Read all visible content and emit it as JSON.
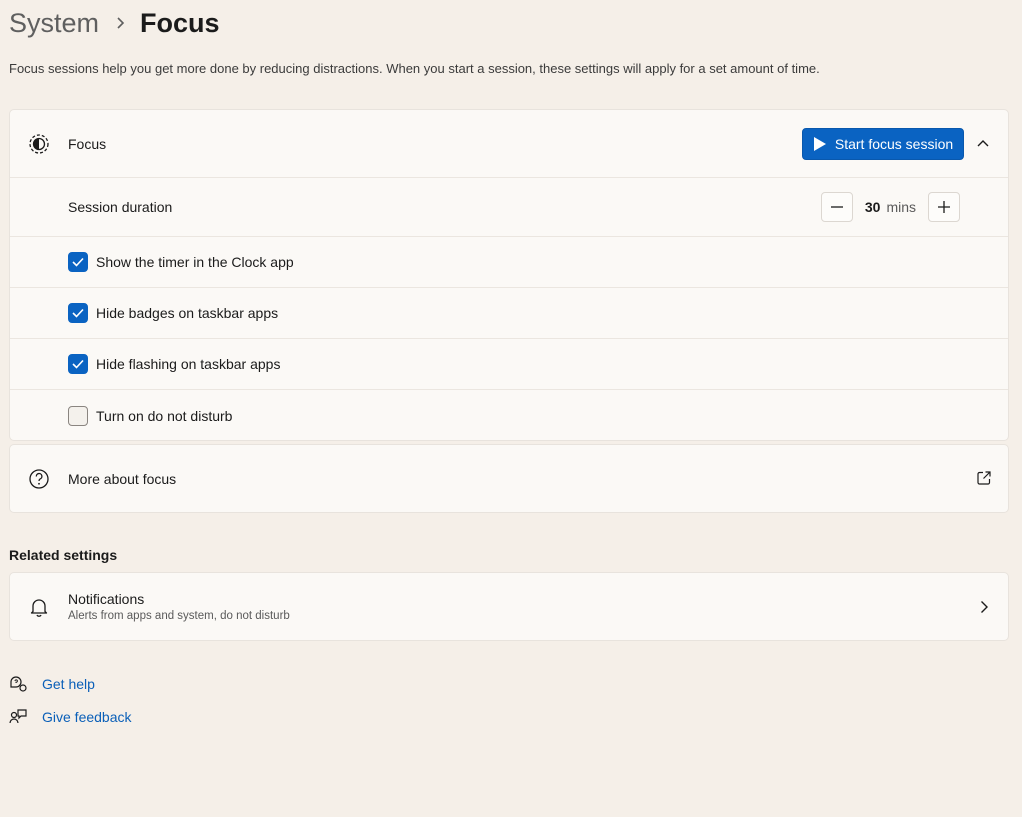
{
  "breadcrumb": {
    "parent": "System",
    "current": "Focus"
  },
  "description": "Focus sessions help you get more done by reducing distractions. When you start a session, these settings will apply for a set amount of time.",
  "focus_card": {
    "title": "Focus",
    "start_button": "Start focus session",
    "session_duration": {
      "label": "Session duration",
      "value": "30",
      "unit": "mins"
    },
    "options": [
      {
        "label": "Show the timer in the Clock app",
        "checked": true
      },
      {
        "label": "Hide badges on taskbar apps",
        "checked": true
      },
      {
        "label": "Hide flashing on taskbar apps",
        "checked": true
      },
      {
        "label": "Turn on do not disturb",
        "checked": false
      }
    ]
  },
  "more_about": {
    "label": "More about focus"
  },
  "related": {
    "title": "Related settings",
    "notifications": {
      "title": "Notifications",
      "subtitle": "Alerts from apps and system, do not disturb"
    }
  },
  "help": {
    "get_help": "Get help",
    "give_feedback": "Give feedback"
  },
  "colors": {
    "accent": "#0a63c2",
    "link": "#0a5fb8",
    "background": "#f5efe8",
    "card": "#fbf9f6"
  }
}
